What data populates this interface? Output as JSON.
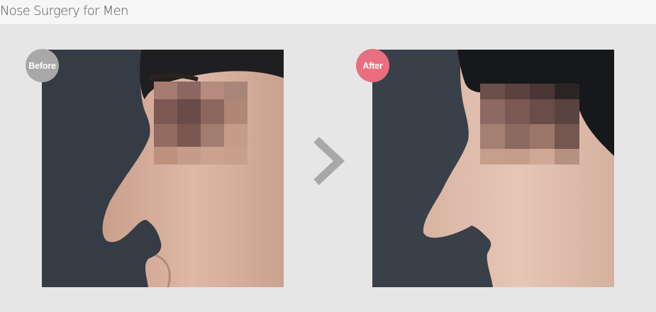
{
  "title": "Nose Surgery for Men",
  "before_label": "Before",
  "after_label": "After",
  "colors": {
    "before_badge": "#a8a8a8",
    "after_badge": "#e96e80",
    "arrow": "#a8a8a8",
    "background": "#e6e6e6"
  }
}
